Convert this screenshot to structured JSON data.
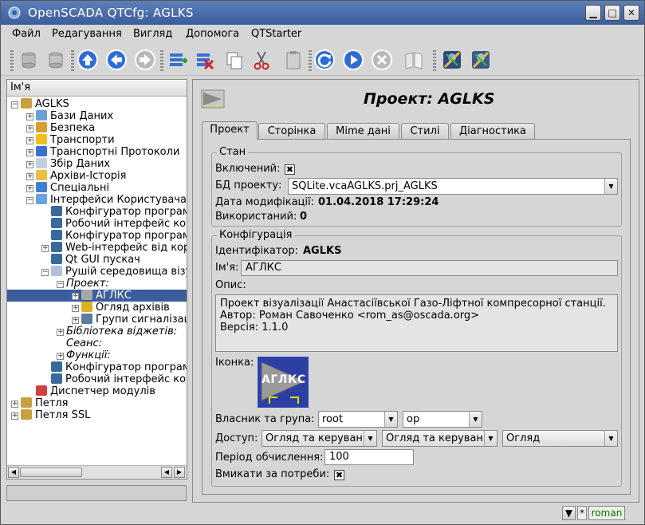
{
  "window": {
    "title": "OpenSCADA QTCfg: AGLKS"
  },
  "menu": [
    {
      "label": "Файл"
    },
    {
      "label": "Редагування"
    },
    {
      "label": "Вигляд"
    },
    {
      "label": "Допомога"
    },
    {
      "label": "QTStarter"
    }
  ],
  "toolbar_icons": [
    "db-load-icon",
    "db-save-icon",
    "up-icon",
    "back-icon",
    "forward-icon",
    "item-add-icon",
    "item-delete-icon",
    "copy-icon",
    "cut-icon",
    "paste-icon",
    "refresh-icon",
    "start-icon",
    "stop-icon",
    "manual-icon",
    "config-module-icon",
    "config-module-icon"
  ],
  "tree": {
    "header": "Ім'я",
    "rows": [
      {
        "label": "AGLKS",
        "level": 0,
        "exp": "-",
        "icon": "#c8a040"
      },
      {
        "label": "Бази Даних",
        "level": 1,
        "exp": "+",
        "icon": "#6aa0d8"
      },
      {
        "label": "Безпека",
        "level": 1,
        "exp": "+",
        "icon": "#d8a030"
      },
      {
        "label": "Транспорти",
        "level": 1,
        "exp": "+",
        "icon": "#f0c020"
      },
      {
        "label": "Транспортні Протоколи",
        "level": 1,
        "exp": "+",
        "icon": "#3a70d0"
      },
      {
        "label": "Збір Даних",
        "level": 1,
        "exp": "+",
        "icon": "#c0d0e0"
      },
      {
        "label": "Архіви-Історія",
        "level": 1,
        "exp": "+",
        "icon": "#e8c040"
      },
      {
        "label": "Спеціальні",
        "level": 1,
        "exp": "+",
        "icon": "#4080d0"
      },
      {
        "label": "Інтерфейси Користувача",
        "level": 1,
        "exp": "-",
        "icon": "#6aa0e0"
      },
      {
        "label": "Конфігуратор програми",
        "level": 2,
        "exp": "",
        "icon": "#3a6a9a"
      },
      {
        "label": "Робочий інтерфейс користувача",
        "level": 2,
        "exp": "",
        "icon": "#3a6a9a"
      },
      {
        "label": "Конфігуратор програми",
        "level": 2,
        "exp": "",
        "icon": "#3a6a9a"
      },
      {
        "label": "Web-інтерфейс від користувача",
        "level": 2,
        "exp": "+",
        "icon": "#3a6a9a"
      },
      {
        "label": "Qt GUI пускач",
        "level": 2,
        "exp": "",
        "icon": "#3a6a9a"
      },
      {
        "label": "Рушій середовища візуалізації",
        "level": 2,
        "exp": "-",
        "icon": "#b0c0d8"
      },
      {
        "label": "Проект:",
        "level": 3,
        "exp": "-",
        "icon": "",
        "italic": true
      },
      {
        "label": "АГЛКС",
        "level": 4,
        "exp": "+",
        "icon": "#a8a8a8",
        "selected": true
      },
      {
        "label": "Огляд архівів",
        "level": 4,
        "exp": "+",
        "icon": "#e0b020"
      },
      {
        "label": "Групи сигналізацій",
        "level": 4,
        "exp": "+",
        "icon": "#5a7aa0"
      },
      {
        "label": "Бібліотека віджетів:",
        "level": 3,
        "exp": "+",
        "icon": "",
        "italic": true
      },
      {
        "label": "Сеанс:",
        "level": 3,
        "exp": "",
        "icon": "",
        "italic": true
      },
      {
        "label": "Функції:",
        "level": 3,
        "exp": "+",
        "icon": "",
        "italic": true
      },
      {
        "label": "Конфігуратор програми",
        "level": 2,
        "exp": "",
        "icon": "#3a6a9a"
      },
      {
        "label": "Робочий інтерфейс користувача",
        "level": 2,
        "exp": "",
        "icon": "#3a6a9a"
      },
      {
        "label": "Диспетчер модулів",
        "level": 1,
        "exp": "",
        "icon": "#d04040"
      },
      {
        "label": "Петля",
        "level": 0,
        "exp": "+",
        "icon": "#c8a040"
      },
      {
        "label": "Петля SSL",
        "level": 0,
        "exp": "+",
        "icon": "#c8a040"
      }
    ]
  },
  "page": {
    "title": "Проект: AGLKS",
    "tabs": [
      {
        "label": "Проект",
        "active": true
      },
      {
        "label": "Сторінка"
      },
      {
        "label": "Mime дані"
      },
      {
        "label": "Стилі"
      },
      {
        "label": "Діагностика"
      }
    ],
    "state": {
      "legend": "Стан",
      "enabled_label": "Включений:",
      "enabled_mark": "✖",
      "db_label": "БД проекту:",
      "db_value": "SQLite.vcaAGLKS.prj_AGLKS",
      "modified_label": "Дата модифікації:",
      "modified_value": "01.04.2018 17:29:24",
      "used_label": "Використаний:",
      "used_value": "0"
    },
    "config": {
      "legend": "Конфігурація",
      "id_label": "Ідентифікатор:",
      "id_value": "AGLKS",
      "name_label": "Ім'я:",
      "name_value": "АГЛКС",
      "descr_label": "Опис:",
      "descr_lines": [
        "Проект візуалізації Анастасіївської Газо-Ліфтної компресорної станції.",
        "Автор: Роман Савоченко <rom_as@oscada.org>",
        "Версія: 1.1.0"
      ],
      "icon_label": "Іконка:",
      "icon_text": "АГЛКС",
      "owner_label": "Власник та група:",
      "owner_value": "root",
      "group_value": "op",
      "access_label": "Доступ:",
      "access_owner": "Огляд та керування",
      "access_group": "Огляд та керування",
      "access_other": "Огляд",
      "period_label": "Період обчислення:",
      "period_value": "100",
      "enable_on_demand_label": "Вмикати за потреби:",
      "enable_on_demand_mark": "✖"
    }
  },
  "statusbar": {
    "user": "roman",
    "mod_mark": "*"
  },
  "colors": {
    "titlebar": "#3a5d9c",
    "selection": "#3a5d9c",
    "background": "#d6d6d6"
  }
}
